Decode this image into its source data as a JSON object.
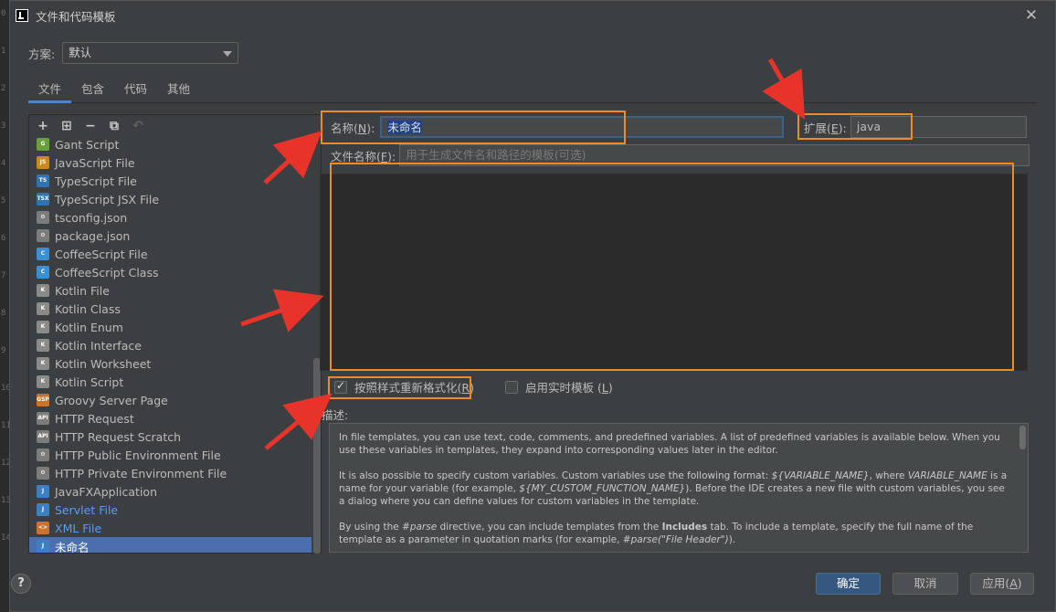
{
  "gutter": [
    "0",
    "1",
    "2",
    "3",
    "4",
    "5",
    "6",
    "7",
    "8",
    "9",
    "10",
    "11",
    "12",
    "13",
    "14"
  ],
  "window": {
    "title": "文件和代码模板",
    "close_icon": "close-icon"
  },
  "scheme": {
    "label": "方案:",
    "value": "默认"
  },
  "tabs": [
    {
      "label": "文件",
      "active": true
    },
    {
      "label": "包含"
    },
    {
      "label": "代码"
    },
    {
      "label": "其他"
    }
  ],
  "toolbar": {
    "add": "+",
    "add_child": "⊞",
    "remove": "−",
    "copy": "⧉",
    "reset": "↶"
  },
  "templates": [
    {
      "label": "Gant Script",
      "icon": "gant-icon",
      "color": "#6a9f3b",
      "tag": "G"
    },
    {
      "label": "JavaScript File",
      "icon": "js-icon",
      "color": "#c98a1e",
      "tag": "JS"
    },
    {
      "label": "TypeScript File",
      "icon": "ts-icon",
      "color": "#2f73b0",
      "tag": "TS"
    },
    {
      "label": "TypeScript JSX File",
      "icon": "tsx-icon",
      "color": "#2f73b0",
      "tag": "TSX"
    },
    {
      "label": "tsconfig.json",
      "icon": "json-gear-icon",
      "color": "#7c7c7c",
      "tag": "⚙"
    },
    {
      "label": "package.json",
      "icon": "json-gear-icon",
      "color": "#7c7c7c",
      "tag": "⚙"
    },
    {
      "label": "CoffeeScript File",
      "icon": "coffee-icon",
      "color": "#3d8fcf",
      "tag": "C"
    },
    {
      "label": "CoffeeScript Class",
      "icon": "coffee-icon",
      "color": "#3d8fcf",
      "tag": "C"
    },
    {
      "label": "Kotlin File",
      "icon": "kotlin-icon",
      "color": "#8a8a8a",
      "tag": "K"
    },
    {
      "label": "Kotlin Class",
      "icon": "kotlin-icon",
      "color": "#8a8a8a",
      "tag": "K"
    },
    {
      "label": "Kotlin Enum",
      "icon": "kotlin-icon",
      "color": "#8a8a8a",
      "tag": "K"
    },
    {
      "label": "Kotlin Interface",
      "icon": "kotlin-icon",
      "color": "#8a8a8a",
      "tag": "K"
    },
    {
      "label": "Kotlin Worksheet",
      "icon": "kotlin-icon",
      "color": "#8a8a8a",
      "tag": "K"
    },
    {
      "label": "Kotlin Script",
      "icon": "kotlin-icon",
      "color": "#8a8a8a",
      "tag": "K"
    },
    {
      "label": "Groovy Server Page",
      "icon": "gsp-icon",
      "color": "#c9742b",
      "tag": "GSP"
    },
    {
      "label": "HTTP Request",
      "icon": "api-icon",
      "color": "#7c7c7c",
      "tag": "API"
    },
    {
      "label": "HTTP Request Scratch",
      "icon": "api-icon",
      "color": "#7c7c7c",
      "tag": "API"
    },
    {
      "label": "HTTP Public Environment File",
      "icon": "http-env-icon",
      "color": "#7c7c7c",
      "tag": "⚙"
    },
    {
      "label": "HTTP Private Environment File",
      "icon": "http-env-icon",
      "color": "#7c7c7c",
      "tag": "⚙"
    },
    {
      "label": "JavaFXApplication",
      "icon": "javafx-icon",
      "color": "#3d7fbf",
      "tag": "J"
    },
    {
      "label": "Servlet File",
      "icon": "servlet-icon",
      "color": "#3d7fbf",
      "tag": "J",
      "blue": true
    },
    {
      "label": "XML File",
      "icon": "xml-icon",
      "color": "#c9742b",
      "tag": "<>",
      "blue": true
    },
    {
      "label": "未命名",
      "icon": "java-icon",
      "color": "#3d7fbf",
      "tag": "J",
      "selected": true
    }
  ],
  "form": {
    "name_label": "名称(",
    "name_mnemonic": "N",
    "name_label_end": "):",
    "name_value": "未命名",
    "ext_label": "扩展(",
    "ext_mnemonic": "E",
    "ext_label_end": "):",
    "ext_value": "java",
    "filename_label": "文件名称(",
    "filename_mnemonic": "F",
    "filename_label_end": "):",
    "filename_placeholder": "用于生成文件名和路径的模板(可选)"
  },
  "options": {
    "reformat_label": "按照样式重新格式化(",
    "reformat_mnemonic": "R",
    "reformat_end": ")",
    "reformat_checked": true,
    "live_label": "启用实时模板 (",
    "live_mnemonic": "L",
    "live_end": ")",
    "live_checked": false
  },
  "description": {
    "label": "描述:",
    "p1": "In file templates, you can use text, code, comments, and predefined variables. A list of predefined variables is available below. When you use these variables in templates, they expand into corresponding values later in the editor.",
    "p2a": "It is also possible to specify custom variables. Custom variables use the following format: ",
    "p2b": "${VARIABLE_NAME}",
    "p2c": ", where ",
    "p2d": "VARIABLE_NAME",
    "p2e": " is a name for your variable (for example, ",
    "p2f": "${MY_CUSTOM_FUNCTION_NAME}",
    "p2g": "). Before the IDE creates a new file with custom variables, you see a dialog where you can define values for custom variables in the template.",
    "p3a": "By using the ",
    "p3b": "#parse",
    "p3c": " directive, you can include templates from the ",
    "p3d": "Includes",
    "p3e": " tab. To include a template, specify the full name of the template as a parameter in quotation marks (for example, ",
    "p3f": "#parse(\"File Header\")",
    "p3g": ")."
  },
  "buttons": {
    "help": "?",
    "ok": "确定",
    "cancel": "取消",
    "apply": "应用(",
    "apply_mnemonic": "A",
    "apply_end": ")"
  },
  "colors": {
    "highlight": "#f08a24",
    "arrow": "#e8332a",
    "accent": "#4b6eaf"
  }
}
